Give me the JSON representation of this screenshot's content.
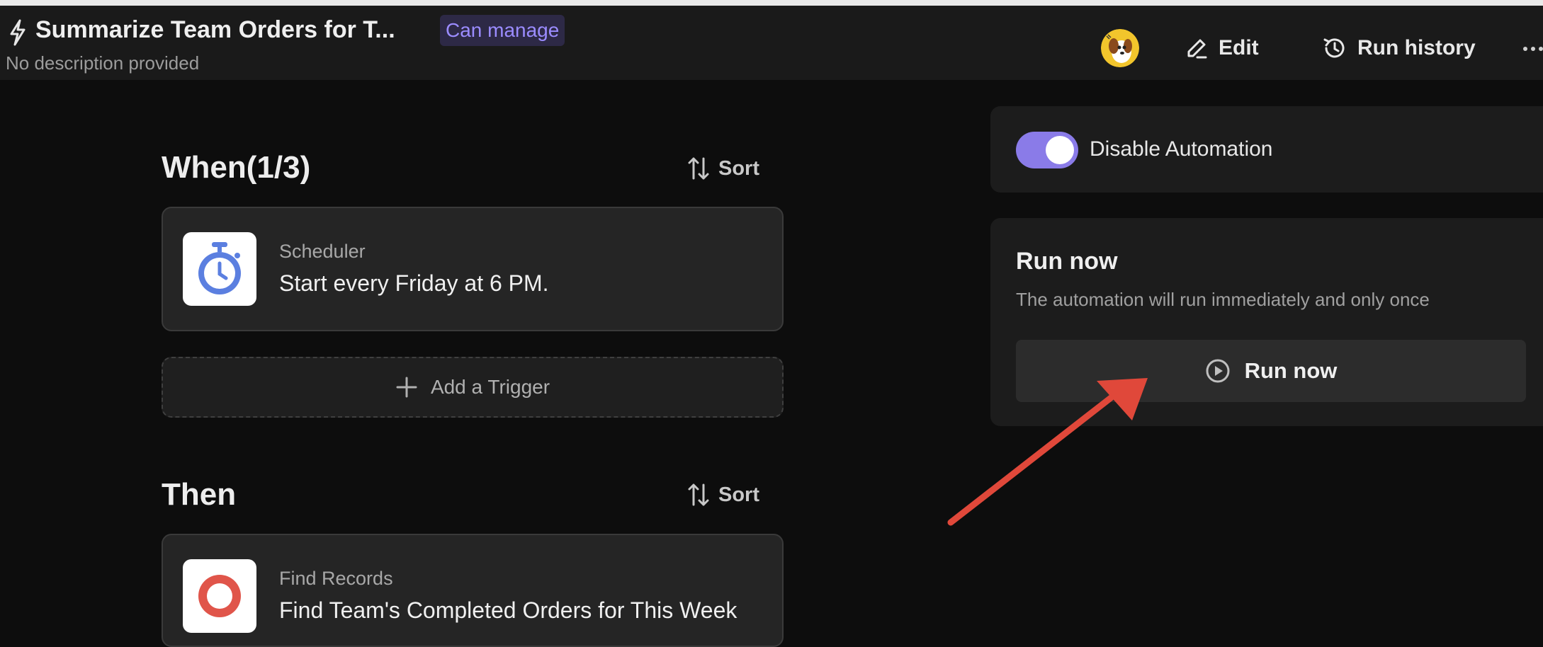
{
  "header": {
    "title": "Summarize Team Orders for T...",
    "badge": "Can manage",
    "subtitle": "No description provided",
    "edit_label": "Edit",
    "history_label": "Run history"
  },
  "when_section": {
    "title": "When(1/3)",
    "sort_label": "Sort",
    "trigger": {
      "kind": "Scheduler",
      "description": "Start every Friday at 6 PM."
    },
    "add_trigger_label": "Add a Trigger"
  },
  "then_section": {
    "title": "Then",
    "sort_label": "Sort",
    "action": {
      "kind": "Find Records",
      "description": "Find Team's Completed Orders for This Week"
    }
  },
  "automation_toggle": {
    "label": "Disable Automation",
    "on": true
  },
  "run_panel": {
    "title": "Run now",
    "description": "The automation will run immediately and only once",
    "button_label": "Run now"
  },
  "colors": {
    "accent": "#8a7be8",
    "badge_text": "#9b8cff",
    "annotation_arrow": "#e0483a"
  }
}
